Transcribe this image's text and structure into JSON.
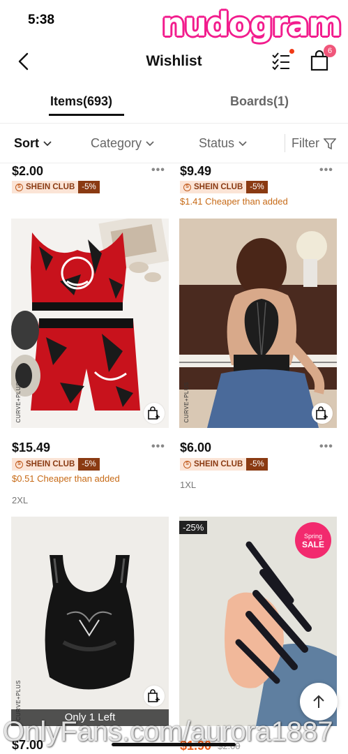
{
  "status": {
    "time": "5:38"
  },
  "watermark": {
    "top": "nudogram",
    "bottom": "OnlyFans.com/aurora1887"
  },
  "nav": {
    "title": "Wishlist",
    "cart_count": "6"
  },
  "tabs": [
    {
      "label": "Items(693)"
    },
    {
      "label": "Boards(1)"
    }
  ],
  "filters": {
    "sort": "Sort",
    "category": "Category",
    "status": "Status",
    "filter": "Filter"
  },
  "club_label": "SHEIN CLUB",
  "products": [
    {
      "price": "$2.00",
      "club_discount": "-5%"
    },
    {
      "price": "$9.49",
      "club_discount": "-5%",
      "cheaper": "$1.41 Cheaper than added"
    },
    {
      "price": "$15.49",
      "club_discount": "-5%",
      "cheaper": "$0.51 Cheaper than added",
      "size": "2XL",
      "brand": "CURVE+PLUS"
    },
    {
      "price": "$6.00",
      "club_discount": "-5%",
      "size": "1XL",
      "brand": "CURVE+PLUS"
    },
    {
      "price": "$7.00",
      "brand": "CURVE+PLUS",
      "stock": "Only 1 Left"
    },
    {
      "price": "$1.90",
      "old_price": "$2.00",
      "discount": "-25%",
      "badge_top": "Spring",
      "badge_bottom": "SALE"
    }
  ],
  "colors": {
    "accent": "#f21c8d",
    "club": "#8a3a12",
    "cheaper": "#c76a16",
    "sale": "#f22a6e"
  }
}
